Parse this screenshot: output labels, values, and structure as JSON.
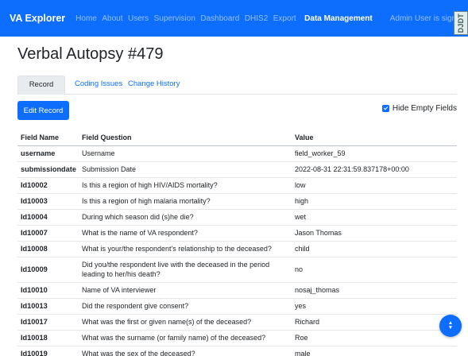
{
  "navbar": {
    "brand": "VA Explorer",
    "links": [
      "Home",
      "About",
      "Users",
      "Supervision",
      "Dashboard",
      "DHIS2",
      "Export"
    ],
    "active_link": "Data Management",
    "signed_in": "Admin User is signed in.",
    "debug_toolbar": "DJDT"
  },
  "page": {
    "title": "Verbal Autopsy #479",
    "tabs": [
      "Record",
      "Coding Issues",
      "Change History"
    ],
    "edit_button": "Edit Record",
    "hide_empty_label": "Hide Empty Fields",
    "hide_empty_checked": true
  },
  "table": {
    "headers": [
      "Field Name",
      "Field Question",
      "Value"
    ],
    "rows": [
      {
        "name": "username",
        "question": "Username",
        "value": "field_worker_59"
      },
      {
        "name": "submissiondate",
        "question": "Submission Date",
        "value": "2022-08-31 22:31:59.837178+00:00"
      },
      {
        "name": "Id10002",
        "question": "Is this a region of high HIV/AIDS mortality?",
        "value": "low"
      },
      {
        "name": "Id10003",
        "question": "Is this a region of high malaria mortality?",
        "value": "high"
      },
      {
        "name": "Id10004",
        "question": "During which season did (s)he die?",
        "value": "wet"
      },
      {
        "name": "Id10007",
        "question": "What is the name of VA respondent?",
        "value": "Jason Thomas"
      },
      {
        "name": "Id10008",
        "question": "What is your/the respondent's relationship to the deceased?",
        "value": "child"
      },
      {
        "name": "Id10009",
        "question": "Did you/the respondent live with the deceased in the period leading to her/his death?",
        "value": "no"
      },
      {
        "name": "Id10010",
        "question": "Name of VA interviewer",
        "value": "nosaj_thomas"
      },
      {
        "name": "Id10013",
        "question": "Did the respondent give consent?",
        "value": "yes"
      },
      {
        "name": "Id10017",
        "question": "What was the first or given name(s) of the deceased?",
        "value": "Richard"
      },
      {
        "name": "Id10018",
        "question": "What was the surname (or family name) of the deceased?",
        "value": "Roe"
      },
      {
        "name": "Id10019",
        "question": "What was the sex of the deceased?",
        "value": "male"
      }
    ]
  },
  "scroll_button": {
    "icon": "up-down-chevron-icon"
  },
  "colors": {
    "primary": "#0d6efd"
  }
}
